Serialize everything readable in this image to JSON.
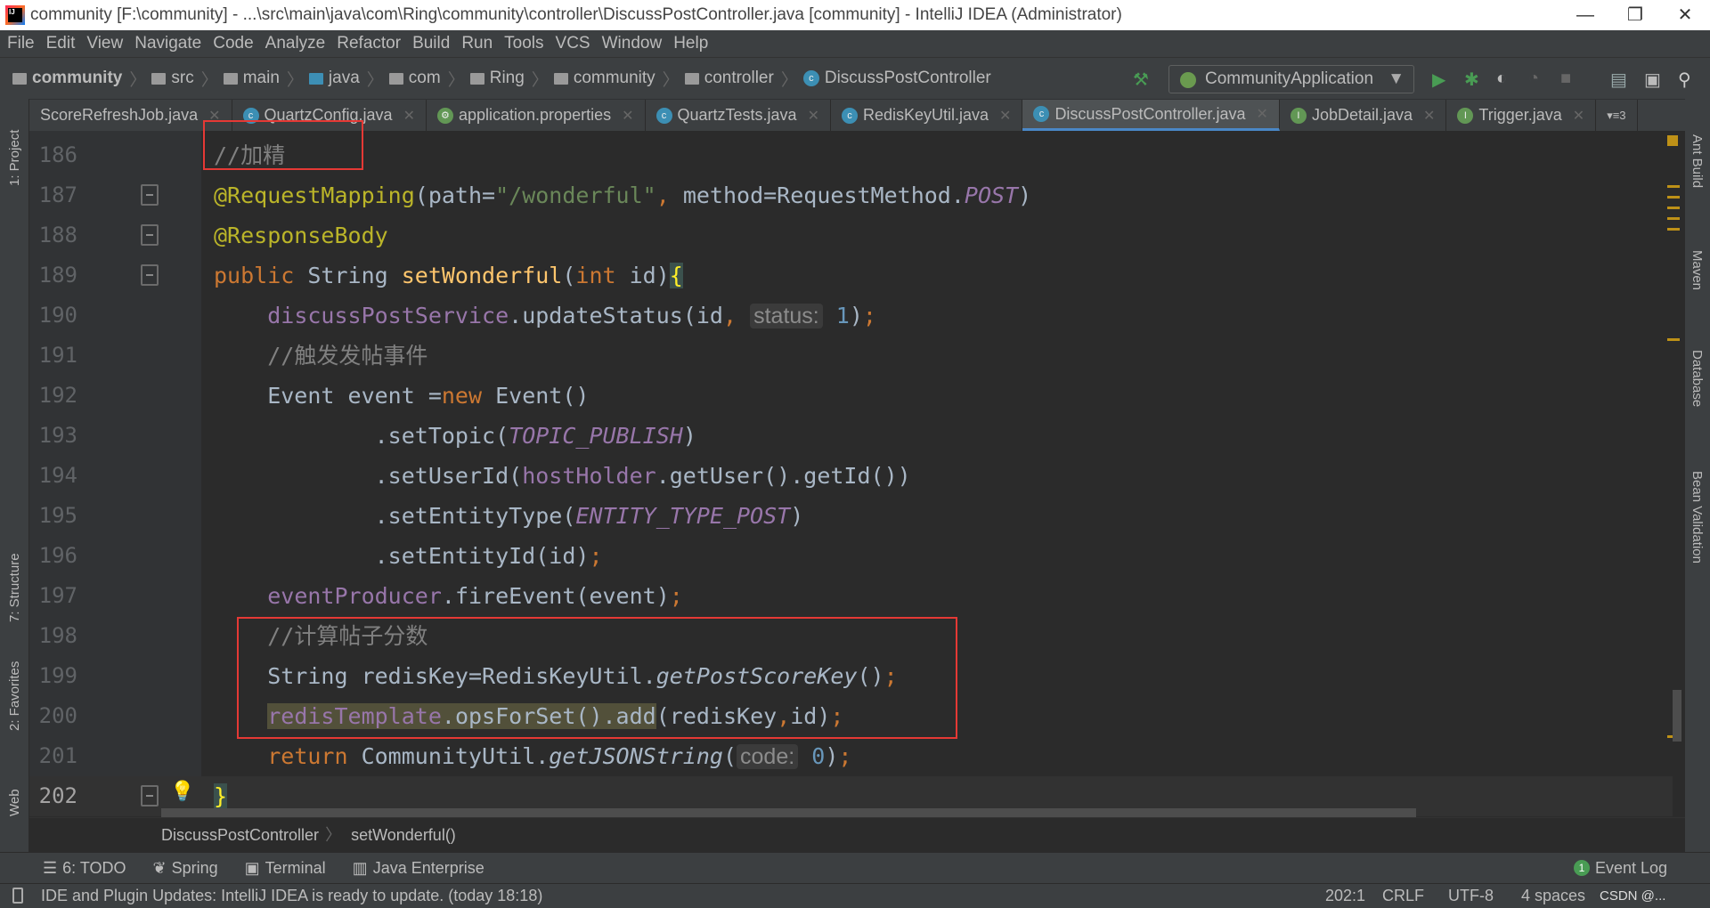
{
  "window": {
    "title": "community [F:\\community] - ...\\src\\main\\java\\com\\Ring\\community\\controller\\DiscussPostController.java [community] - IntelliJ IDEA (Administrator)",
    "logo": "IJ"
  },
  "menu": [
    "File",
    "Edit",
    "View",
    "Navigate",
    "Code",
    "Analyze",
    "Refactor",
    "Build",
    "Run",
    "Tools",
    "VCS",
    "Window",
    "Help"
  ],
  "nav": {
    "crumbs": [
      {
        "label": "community",
        "icon": "project-folder-icon"
      },
      {
        "label": "src",
        "icon": "folder-icon"
      },
      {
        "label": "main",
        "icon": "folder-icon"
      },
      {
        "label": "java",
        "icon": "source-folder-icon"
      },
      {
        "label": "com",
        "icon": "package-icon"
      },
      {
        "label": "Ring",
        "icon": "package-icon"
      },
      {
        "label": "community",
        "icon": "package-icon"
      },
      {
        "label": "controller",
        "icon": "package-icon"
      },
      {
        "label": "DiscussPostController",
        "icon": "class-icon"
      }
    ],
    "run_config": "CommunityApplication"
  },
  "tabs": [
    {
      "label": "ScoreRefreshJob.java",
      "icon": "none"
    },
    {
      "label": "QuartzConfig.java",
      "icon": "C"
    },
    {
      "label": "application.properties",
      "icon": "spring"
    },
    {
      "label": "QuartzTests.java",
      "icon": "C"
    },
    {
      "label": "RedisKeyUtil.java",
      "icon": "C"
    },
    {
      "label": "DiscussPostController.java",
      "icon": "C",
      "active": true
    },
    {
      "label": "JobDetail.java",
      "icon": "I"
    },
    {
      "label": "Trigger.java",
      "icon": "I"
    }
  ],
  "tabs_overflow": "▾≡3",
  "left_tools": [
    "1: Project",
    "7: Structure",
    "2: Favorites",
    "Web"
  ],
  "right_tools": [
    "Ant Build",
    "Maven",
    "Database",
    "Bean Validation"
  ],
  "editor": {
    "current_line": 202,
    "lines": [
      {
        "n": 186,
        "t": [
          [
            "cm",
            "//加精"
          ]
        ]
      },
      {
        "n": 187,
        "t": [
          [
            "an",
            "@RequestMapping"
          ],
          [
            "",
            "(path="
          ],
          [
            "st",
            "\"/wonderful\""
          ],
          [
            "kw",
            ", "
          ],
          [
            "",
            "method=RequestMethod."
          ],
          [
            "cn",
            "POST"
          ],
          [
            "",
            ")"
          ]
        ]
      },
      {
        "n": 188,
        "t": [
          [
            "an",
            "@ResponseBody"
          ]
        ]
      },
      {
        "n": 189,
        "t": [
          [
            "kw",
            "public "
          ],
          [
            "",
            "String "
          ],
          [
            "md",
            "setWonderful"
          ],
          [
            "",
            "("
          ],
          [
            "kw",
            "int "
          ],
          [
            "",
            "id)"
          ],
          [
            "brc",
            "{"
          ]
        ]
      },
      {
        "n": 190,
        "t": [
          [
            "",
            "    "
          ],
          [
            "fd",
            "discussPostService"
          ],
          [
            "",
            ".updateStatus(id"
          ],
          [
            "kw",
            ", "
          ],
          [
            "hint",
            "status:"
          ],
          [
            "nm",
            " 1"
          ],
          [
            "",
            ")"
          ],
          [
            "kw",
            ";"
          ]
        ]
      },
      {
        "n": 191,
        "t": [
          [
            "",
            "    "
          ],
          [
            "cm",
            "//触发发帖事件"
          ]
        ]
      },
      {
        "n": 192,
        "t": [
          [
            "",
            "    Event event ="
          ],
          [
            "kw",
            "new "
          ],
          [
            "",
            "Event()"
          ]
        ]
      },
      {
        "n": 193,
        "t": [
          [
            "",
            "            .setTopic("
          ],
          [
            "cn",
            "TOPIC_PUBLISH"
          ],
          [
            "",
            ")"
          ]
        ]
      },
      {
        "n": 194,
        "t": [
          [
            "",
            "            .setUserId("
          ],
          [
            "fd",
            "hostHolder"
          ],
          [
            "",
            ".getUser().getId())"
          ]
        ]
      },
      {
        "n": 195,
        "t": [
          [
            "",
            "            .setEntityType("
          ],
          [
            "cn",
            "ENTITY_TYPE_POST"
          ],
          [
            "",
            ")"
          ]
        ]
      },
      {
        "n": 196,
        "t": [
          [
            "",
            "            .setEntityId(id)"
          ],
          [
            "kw",
            ";"
          ]
        ]
      },
      {
        "n": 197,
        "t": [
          [
            "",
            "    "
          ],
          [
            "fd",
            "eventProducer"
          ],
          [
            "",
            ".fireEvent(event)"
          ],
          [
            "kw",
            ";"
          ]
        ]
      },
      {
        "n": 198,
        "t": [
          [
            "",
            "    "
          ],
          [
            "cm",
            "//计算帖子分数"
          ]
        ]
      },
      {
        "n": 199,
        "t": [
          [
            "",
            "    String redisKey=RedisKeyUtil."
          ],
          [
            "it",
            "getPostScoreKey"
          ],
          [
            "",
            "()"
          ],
          [
            "kw",
            ";"
          ]
        ]
      },
      {
        "n": 200,
        "t": [
          [
            "",
            "    "
          ],
          [
            "hl fd",
            "redisTemplate"
          ],
          [
            "hl",
            ".opsForSet().add"
          ],
          [
            "",
            "(redisKey"
          ],
          [
            "kw",
            ","
          ],
          [
            "",
            "id)"
          ],
          [
            "kw",
            ";"
          ]
        ]
      },
      {
        "n": 201,
        "t": [
          [
            "",
            "    "
          ],
          [
            "kw",
            "return "
          ],
          [
            "",
            "CommunityUtil."
          ],
          [
            "it",
            "getJSONString"
          ],
          [
            "",
            "("
          ],
          [
            "hint",
            "code:"
          ],
          [
            "nm",
            " 0"
          ],
          [
            "",
            ")"
          ],
          [
            "kw",
            ";"
          ]
        ]
      },
      {
        "n": 202,
        "t": [
          [
            "brc",
            "}"
          ]
        ]
      }
    ]
  },
  "breadcrumb": [
    "DiscussPostController",
    "setWonderful()"
  ],
  "tool_windows": [
    {
      "label": "6: TODO",
      "icon": "list-icon"
    },
    {
      "label": "Spring",
      "icon": "spring-icon"
    },
    {
      "label": "Terminal",
      "icon": "terminal-icon"
    },
    {
      "label": "Java Enterprise",
      "icon": "java-enterprise-icon"
    }
  ],
  "event_log": {
    "label": "Event Log",
    "count": "1"
  },
  "status": {
    "message": "IDE and Plugin Updates: IntelliJ IDEA is ready to update. (today 18:18)",
    "position": "202:1",
    "line_sep": "CRLF",
    "encoding": "UTF-8",
    "indent": "4 spaces",
    "watermark": "CSDN @..."
  }
}
